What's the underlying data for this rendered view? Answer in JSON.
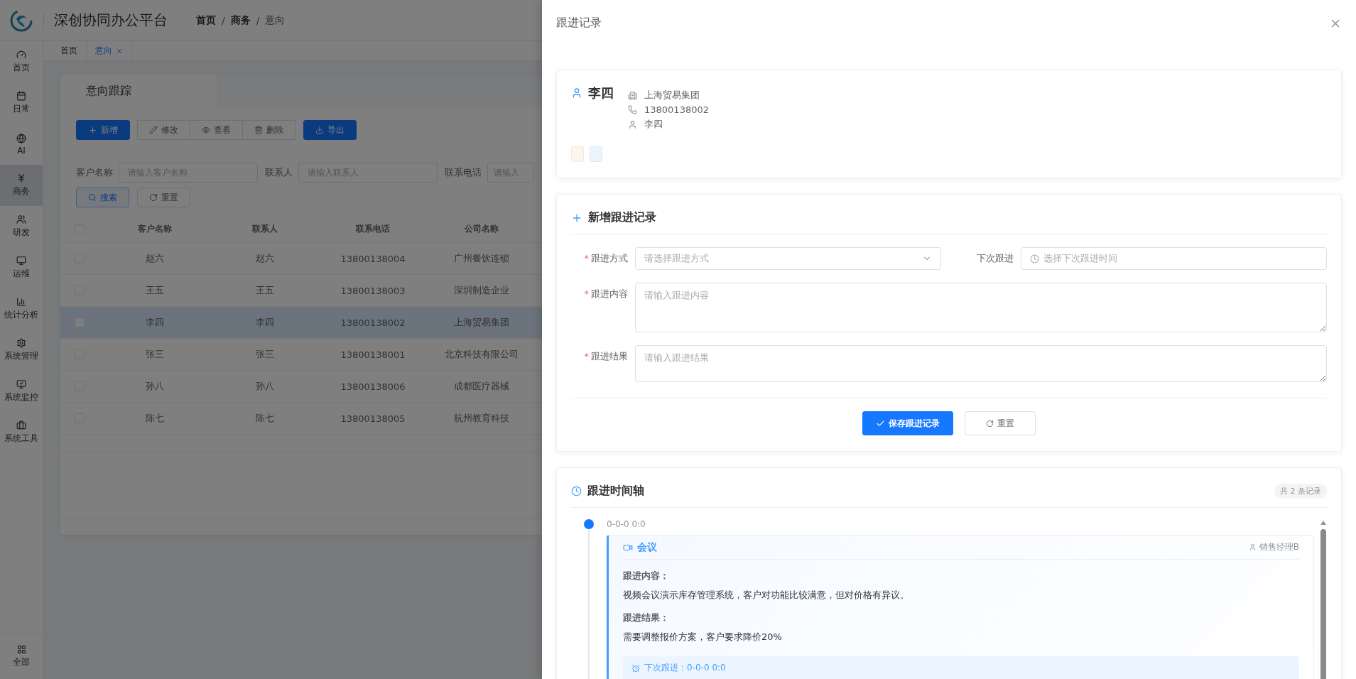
{
  "app": {
    "title": "深创协同办公平台"
  },
  "breadcrumb": {
    "separator": "/",
    "items": [
      "首页",
      "商务",
      "意向"
    ]
  },
  "sidebar": {
    "items": [
      {
        "label": "首页",
        "selected": false
      },
      {
        "label": "日常",
        "selected": false
      },
      {
        "label": "AI",
        "selected": false
      },
      {
        "label": "商务",
        "selected": true
      },
      {
        "label": "研发",
        "selected": false
      },
      {
        "label": "运维",
        "selected": false
      },
      {
        "label": "统计分析",
        "selected": false
      },
      {
        "label": "系统管理",
        "selected": false
      },
      {
        "label": "系统监控",
        "selected": false
      },
      {
        "label": "系统工具",
        "selected": false
      }
    ],
    "bottom": "全部"
  },
  "page_tabs": [
    {
      "label": "首页",
      "selected": false,
      "closable": false
    },
    {
      "label": "意向",
      "selected": true,
      "closable": true
    }
  ],
  "card_tab": "意向跟踪",
  "toolbar": {
    "add": "新增",
    "edit": "修改",
    "view": "查看",
    "delete": "删除",
    "export": "导出"
  },
  "filters": [
    {
      "label": "客户名称",
      "placeholder": "请输入客户名称"
    },
    {
      "label": "联系人",
      "placeholder": "请输入联系人"
    },
    {
      "label": "联系电话",
      "placeholder": "请输入"
    }
  ],
  "filter_buttons": {
    "search": "搜索",
    "reset": "重置"
  },
  "table": {
    "header_checked": false,
    "columns": [
      "客户名称",
      "联系人",
      "联系电话",
      "公司名称"
    ],
    "rows": [
      {
        "cells": [
          "赵六",
          "赵六",
          "13800138004",
          "广州餐饮连锁"
        ],
        "selected": false,
        "checked": false
      },
      {
        "cells": [
          "王五",
          "王五",
          "13800138003",
          "深圳制造企业"
        ],
        "selected": false,
        "checked": false
      },
      {
        "cells": [
          "李四",
          "李四",
          "13800138002",
          "上海贸易集团"
        ],
        "selected": true,
        "checked": false
      },
      {
        "cells": [
          "张三",
          "张三",
          "13800138001",
          "北京科技有限公司"
        ],
        "selected": false,
        "checked": false
      },
      {
        "cells": [
          "孙八",
          "孙八",
          "13800138006",
          "成都医疗器械"
        ],
        "selected": false,
        "checked": false
      },
      {
        "cells": [
          "陈七",
          "陈七",
          "13800138005",
          "杭州教育科技"
        ],
        "selected": false,
        "checked": false
      }
    ]
  },
  "drawer": {
    "title": "跟进记录",
    "customer": {
      "name": "李四",
      "company": "上海贸易集团",
      "phone": "13800138002",
      "contact": "李四",
      "tags": [
        {
          "color": "#fdf6ec"
        },
        {
          "color": "#ecf5ff"
        }
      ]
    },
    "form": {
      "title": "新增跟进记录",
      "required_mark": "*",
      "fields": [
        {
          "kind": "select",
          "label": "跟进方式",
          "placeholder": "请选择跟进方式",
          "required": true
        },
        {
          "kind": "date",
          "label": "下次跟进",
          "placeholder": "选择下次跟进时间",
          "required": false
        },
        {
          "kind": "textarea",
          "label": "跟进内容",
          "placeholder": "请输入跟进内容",
          "required": true
        },
        {
          "kind": "textarea",
          "label": "跟进结果",
          "placeholder": "请输入跟进结果",
          "required": true
        }
      ],
      "save": "保存跟进记录",
      "reset": "重置"
    },
    "timeline": {
      "title": "跟进时间轴",
      "count": "共 2 条记录",
      "items": [
        {
          "time": "0-0-0 0:0",
          "type": "会议",
          "owner": "销售经理B",
          "content_label": "跟进内容：",
          "content": "视频会议演示库存管理系统，客户对功能比较满意，但对价格有异议。",
          "result_label": "跟进结果：",
          "result": "需要调整报价方案，客户要求降价20%",
          "next": "下次跟进：0-0-0 0:0"
        }
      ]
    }
  }
}
